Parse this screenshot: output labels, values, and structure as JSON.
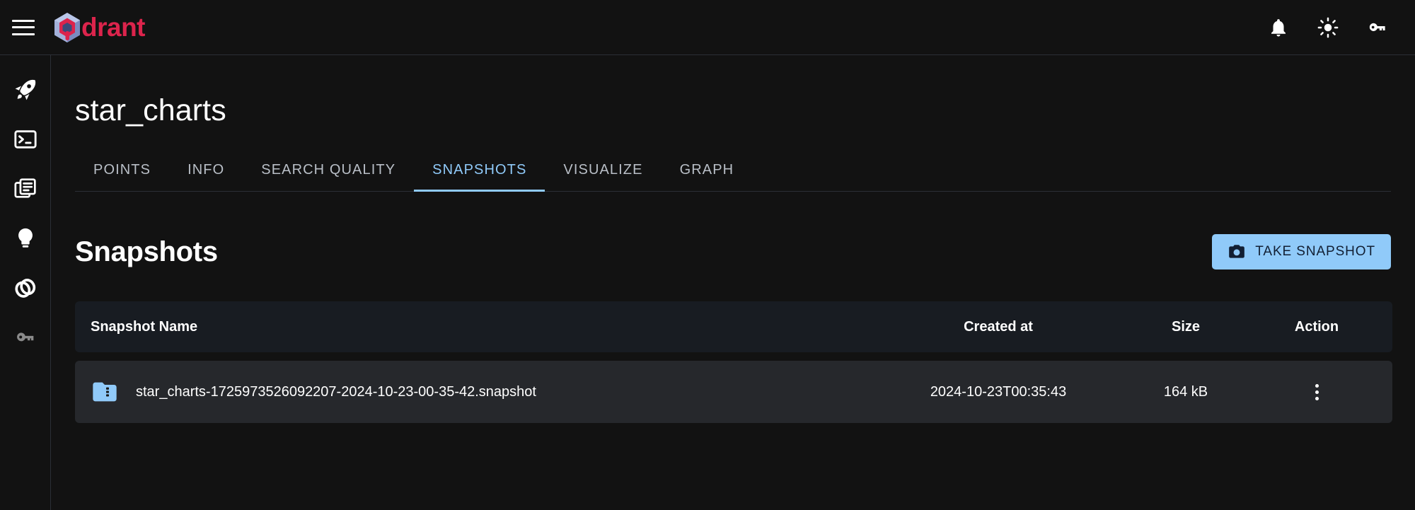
{
  "brand": {
    "name": "drant",
    "logo_icon": "qdrant-cube-logo",
    "menu_icon": "hamburger-menu-icon"
  },
  "topbar": {
    "actions": [
      {
        "icon": "bell-icon",
        "name": "notifications-button"
      },
      {
        "icon": "sun-icon",
        "name": "theme-toggle-button"
      },
      {
        "icon": "key-icon",
        "name": "api-key-button"
      }
    ]
  },
  "sidebar": {
    "items": [
      {
        "icon": "rocket-icon",
        "name": "sidebar-item-welcome"
      },
      {
        "icon": "console-icon",
        "name": "sidebar-item-console"
      },
      {
        "icon": "collections-icon",
        "name": "sidebar-item-collections"
      },
      {
        "icon": "lightbulb-icon",
        "name": "sidebar-item-tutorial"
      },
      {
        "icon": "datasets-icon",
        "name": "sidebar-item-datasets"
      },
      {
        "icon": "key-icon",
        "name": "sidebar-item-access"
      }
    ]
  },
  "page": {
    "title": "star_charts",
    "tabs": [
      {
        "label": "POINTS",
        "active": false
      },
      {
        "label": "INFO",
        "active": false
      },
      {
        "label": "SEARCH QUALITY",
        "active": false
      },
      {
        "label": "SNAPSHOTS",
        "active": true
      },
      {
        "label": "VISUALIZE",
        "active": false
      },
      {
        "label": "GRAPH",
        "active": false
      }
    ],
    "section_title": "Snapshots",
    "take_snapshot_label": "TAKE SNAPSHOT",
    "take_snapshot_icon": "camera-icon"
  },
  "table": {
    "columns": [
      "Snapshot Name",
      "Created at",
      "Size",
      "Action"
    ],
    "rows": [
      {
        "icon": "folder-zip-icon",
        "name": "star_charts-1725973526092207-2024-10-23-00-35-42.snapshot",
        "created_at": "2024-10-23T00:35:43",
        "size": "164 kB",
        "action_icon": "more-vertical-icon"
      }
    ]
  },
  "colors": {
    "background": "#121212",
    "accent_blue": "#90caf9",
    "brand_red": "#dc244c",
    "logo_blue": "#a7b6dd",
    "header_row": "#181c22",
    "data_row": "#26282c",
    "border": "#2b2f36"
  }
}
